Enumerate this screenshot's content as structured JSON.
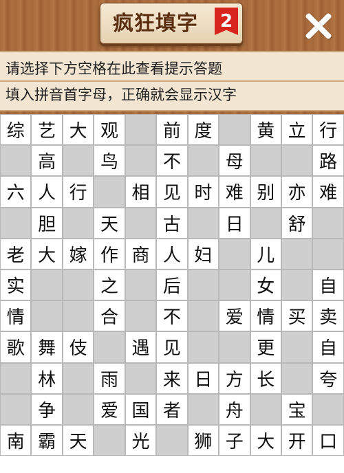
{
  "header": {
    "title": "疯狂填字",
    "level_badge": "2",
    "close_icon": "close-icon"
  },
  "hint": {
    "line1": "请选择下方空格在此查看提示答题",
    "line2": "填入拼音首字母，正确就会显示汉字"
  },
  "grid": {
    "rows": [
      [
        "综",
        "艺",
        "大",
        "观",
        null,
        "前",
        "度",
        null,
        "黄",
        "立",
        "行"
      ],
      [
        null,
        "高",
        null,
        "鸟",
        null,
        "不",
        null,
        "母",
        null,
        null,
        "路"
      ],
      [
        "六",
        "人",
        "行",
        null,
        "相",
        "见",
        "时",
        "难",
        "别",
        "亦",
        "难"
      ],
      [
        null,
        "胆",
        null,
        "天",
        null,
        "古",
        null,
        "日",
        null,
        "舒",
        null
      ],
      [
        "老",
        "大",
        "嫁",
        "作",
        "商",
        "人",
        "妇",
        null,
        "儿",
        null,
        null
      ],
      [
        "实",
        null,
        null,
        "之",
        null,
        "后",
        null,
        null,
        "女",
        null,
        "自"
      ],
      [
        "情",
        null,
        null,
        "合",
        null,
        "不",
        null,
        "爱",
        "情",
        "买",
        "卖"
      ],
      [
        "歌",
        "舞",
        "伎",
        null,
        "遇",
        "见",
        null,
        null,
        "更",
        null,
        "自"
      ],
      [
        null,
        "林",
        null,
        "雨",
        null,
        "来",
        "日",
        "方",
        "长",
        null,
        "夸"
      ],
      [
        null,
        "争",
        null,
        "爱",
        "国",
        "者",
        null,
        "舟",
        null,
        "宝",
        null
      ],
      [
        "南",
        "霸",
        "天",
        null,
        "光",
        null,
        "狮",
        "子",
        "大",
        "开",
        "口"
      ]
    ],
    "blocked": [
      [
        0,
        4
      ],
      [
        0,
        7
      ],
      [
        1,
        0
      ],
      [
        1,
        2
      ],
      [
        1,
        4
      ],
      [
        1,
        6
      ],
      [
        1,
        8
      ],
      [
        1,
        9
      ],
      [
        2,
        3
      ],
      [
        3,
        0
      ],
      [
        3,
        2
      ],
      [
        3,
        4
      ],
      [
        3,
        6
      ],
      [
        3,
        8
      ],
      [
        3,
        10
      ],
      [
        4,
        7
      ],
      [
        4,
        9
      ],
      [
        4,
        10
      ],
      [
        5,
        1
      ],
      [
        5,
        2
      ],
      [
        5,
        4
      ],
      [
        5,
        6
      ],
      [
        5,
        7
      ],
      [
        5,
        9
      ],
      [
        6,
        1
      ],
      [
        6,
        2
      ],
      [
        6,
        4
      ],
      [
        6,
        6
      ],
      [
        7,
        3
      ],
      [
        7,
        6
      ],
      [
        7,
        7
      ],
      [
        7,
        9
      ],
      [
        8,
        0
      ],
      [
        8,
        2
      ],
      [
        8,
        4
      ],
      [
        8,
        9
      ],
      [
        9,
        0
      ],
      [
        9,
        2
      ],
      [
        9,
        6
      ],
      [
        9,
        8
      ],
      [
        9,
        10
      ],
      [
        10,
        3
      ],
      [
        10,
        5
      ]
    ]
  }
}
